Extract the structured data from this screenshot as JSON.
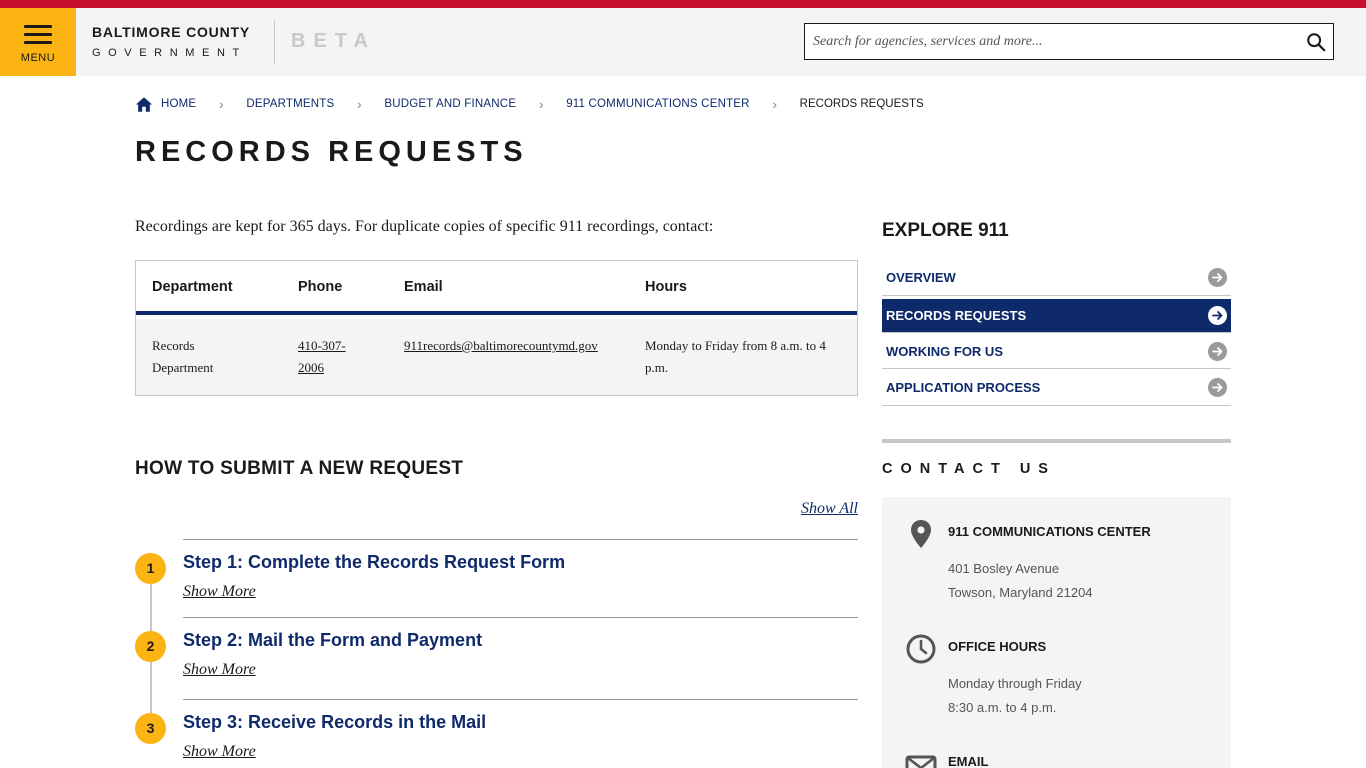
{
  "header": {
    "menu_label": "MENU",
    "logo_line1": "BALTIMORE COUNTY",
    "logo_line2": "GOVERNMENT",
    "beta": "BETA",
    "search_placeholder": "Search for agencies, services and more..."
  },
  "breadcrumb": {
    "items": [
      "HOME",
      "DEPARTMENTS",
      "BUDGET AND FINANCE",
      "911 COMMUNICATIONS CENTER"
    ],
    "current": "RECORDS REQUESTS"
  },
  "page_title": "RECORDS REQUESTS",
  "intro": "Recordings are kept for 365 days. For duplicate copies of specific 911 recordings, contact:",
  "table": {
    "headers": [
      "Department",
      "Phone",
      "Email",
      "Hours"
    ],
    "rows": [
      {
        "department": "Records Department",
        "phone": "410-307-2006",
        "email": "911records@baltimorecountymd.gov",
        "hours": "Monday to Friday from 8 a.m. to 4 p.m."
      }
    ]
  },
  "submit": {
    "heading": "HOW TO SUBMIT A NEW REQUEST",
    "show_all": "Show All",
    "steps": [
      {
        "num": "1",
        "title": "Step 1: Complete the Records Request Form",
        "more": "Show More"
      },
      {
        "num": "2",
        "title": "Step 2: Mail the Form and Payment",
        "more": "Show More"
      },
      {
        "num": "3",
        "title": "Step 3: Receive Records in the Mail",
        "more": "Show More"
      }
    ]
  },
  "sidebar": {
    "heading": "EXPLORE 911",
    "items": [
      {
        "label": "OVERVIEW",
        "active": false
      },
      {
        "label": "RECORDS REQUESTS",
        "active": true
      },
      {
        "label": "WORKING FOR US",
        "active": false
      },
      {
        "label": "APPLICATION PROCESS",
        "active": false
      }
    ],
    "contact_heading": "CONTACT US",
    "contact": {
      "location_title": "911 COMMUNICATIONS CENTER",
      "address1": "401 Bosley Avenue",
      "address2": "Towson, Maryland 21204",
      "hours_title": "OFFICE HOURS",
      "hours1": "Monday through Friday",
      "hours2": "8:30 a.m. to 4 p.m.",
      "email_title": "EMAIL"
    }
  },
  "colors": {
    "top_bar": "#c8102e",
    "menu_bg": "#fcb314",
    "navy": "#0f2a6b",
    "step_circle": "#fcb314"
  },
  "icons": [
    "menu-icon",
    "search-icon",
    "home-icon",
    "chevron-right-icon",
    "arrow-right-circle-icon",
    "location-pin-icon",
    "clock-icon",
    "envelope-icon"
  ]
}
